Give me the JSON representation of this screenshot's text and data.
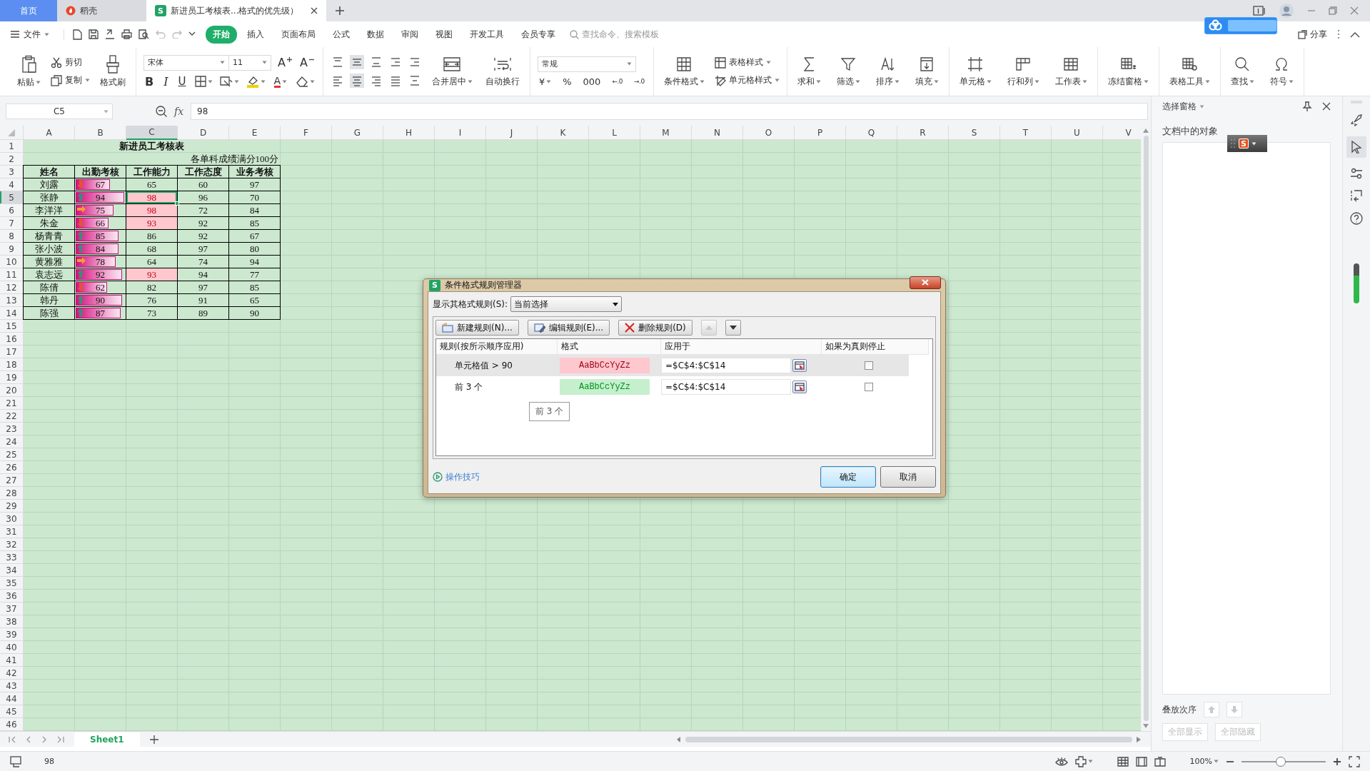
{
  "app_tabs": [
    {
      "label": "首页",
      "kind": "home",
      "selected": false
    },
    {
      "label": "稻壳",
      "kind": "docer",
      "selected": false
    },
    {
      "label": "新进员工考核表...格式的优先级）",
      "kind": "sheet",
      "logo": "S",
      "selected": true
    }
  ],
  "menu": {
    "file": "文件",
    "tabs": [
      {
        "label": "开始",
        "selected": true
      },
      {
        "label": "插入",
        "selected": false
      },
      {
        "label": "页面布局",
        "selected": false
      },
      {
        "label": "公式",
        "selected": false
      },
      {
        "label": "数据",
        "selected": false
      },
      {
        "label": "审阅",
        "selected": false
      },
      {
        "label": "视图",
        "selected": false
      },
      {
        "label": "开发工具",
        "selected": false
      },
      {
        "label": "会员专享",
        "selected": false
      }
    ],
    "search": {
      "placeholder": "查找命令、搜索模板"
    },
    "share": "分享"
  },
  "ribbon": {
    "paste": "粘贴",
    "cut": "剪切",
    "copy": "复制",
    "format_painter": "格式刷",
    "font": "宋体",
    "font_size": "11",
    "grow_font": "A",
    "shrink_font": "A",
    "bold": "B",
    "italic": "I",
    "underline": "U",
    "font_color": "A",
    "merge": "合并居中",
    "wrap": "自动换行",
    "number_format": "常规",
    "currency": "¥",
    "percent": "%",
    "thousands": "000",
    "decimal_increase": "←.0",
    "decimal_decrease": "→.0",
    "conditional_format": "条件格式",
    "table_style": "表格样式",
    "cell_style": "单元格样式",
    "tools": [
      "求和",
      "筛选",
      "排序",
      "填充",
      "单元格",
      "行和列",
      "工作表",
      "冻结窗格",
      "表格工具",
      "查找",
      "符号"
    ]
  },
  "formula_bar": {
    "cell_ref": "C5",
    "fx": "fx",
    "value": "98"
  },
  "sheet": {
    "columns": [
      {
        "label": "A",
        "selected": false
      },
      {
        "label": "B",
        "selected": false
      },
      {
        "label": "C",
        "selected": true
      },
      {
        "label": "D",
        "selected": false
      },
      {
        "label": "E",
        "selected": false
      },
      {
        "label": "F",
        "selected": false
      },
      {
        "label": "G",
        "selected": false
      },
      {
        "label": "H",
        "selected": false
      },
      {
        "label": "I",
        "selected": false
      },
      {
        "label": "J",
        "selected": false
      },
      {
        "label": "K",
        "selected": false
      },
      {
        "label": "L",
        "selected": false
      },
      {
        "label": "M",
        "selected": false
      },
      {
        "label": "N",
        "selected": false
      },
      {
        "label": "O",
        "selected": false
      },
      {
        "label": "P",
        "selected": false
      },
      {
        "label": "Q",
        "selected": false
      },
      {
        "label": "R",
        "selected": false
      },
      {
        "label": "S",
        "selected": false
      },
      {
        "label": "T",
        "selected": false
      },
      {
        "label": "U",
        "selected": false
      },
      {
        "label": "V",
        "selected": false
      }
    ],
    "row_headers": [
      {
        "label": "1",
        "selected": false
      },
      {
        "label": "2",
        "selected": false
      },
      {
        "label": "3",
        "selected": false
      },
      {
        "label": "4",
        "selected": false
      },
      {
        "label": "5",
        "selected": true
      },
      {
        "label": "6",
        "selected": false
      },
      {
        "label": "7",
        "selected": false
      },
      {
        "label": "8",
        "selected": false
      },
      {
        "label": "9",
        "selected": false
      },
      {
        "label": "10",
        "selected": false
      },
      {
        "label": "11",
        "selected": false
      },
      {
        "label": "12",
        "selected": false
      },
      {
        "label": "13",
        "selected": false
      },
      {
        "label": "14",
        "selected": false
      },
      {
        "label": "15",
        "selected": false
      },
      {
        "label": "16",
        "selected": false
      },
      {
        "label": "17",
        "selected": false
      },
      {
        "label": "18",
        "selected": false
      },
      {
        "label": "19",
        "selected": false
      },
      {
        "label": "20",
        "selected": false
      },
      {
        "label": "21",
        "selected": false
      },
      {
        "label": "22",
        "selected": false
      },
      {
        "label": "23",
        "selected": false
      },
      {
        "label": "24",
        "selected": false
      },
      {
        "label": "25",
        "selected": false
      },
      {
        "label": "26",
        "selected": false
      },
      {
        "label": "27",
        "selected": false
      },
      {
        "label": "28",
        "selected": false
      },
      {
        "label": "29",
        "selected": false
      },
      {
        "label": "30",
        "selected": false
      },
      {
        "label": "31",
        "selected": false
      },
      {
        "label": "32",
        "selected": false
      },
      {
        "label": "33",
        "selected": false
      },
      {
        "label": "34",
        "selected": false
      },
      {
        "label": "35",
        "selected": false
      },
      {
        "label": "36",
        "selected": false
      },
      {
        "label": "37",
        "selected": false
      },
      {
        "label": "38",
        "selected": false
      },
      {
        "label": "39",
        "selected": false
      },
      {
        "label": "40",
        "selected": false
      },
      {
        "label": "41",
        "selected": false
      },
      {
        "label": "42",
        "selected": false
      },
      {
        "label": "43",
        "selected": false
      },
      {
        "label": "44",
        "selected": false
      },
      {
        "label": "45",
        "selected": false
      },
      {
        "label": "46",
        "selected": false
      }
    ],
    "title": "新进员工考核表",
    "note": "各单科成绩满分100分",
    "headers": [
      "姓名",
      "出勤考核",
      "工作能力",
      "工作态度",
      "业务考核"
    ],
    "records": [
      {
        "name": "刘露",
        "attendance": "67",
        "kind": "down",
        "level": 0.7,
        "ability": "65",
        "ability_highlight": false,
        "ability_selected": false,
        "attitude": "60",
        "business": "97"
      },
      {
        "name": "张静",
        "attendance": "94",
        "kind": "up",
        "level": 0.99,
        "ability": "98",
        "ability_highlight": true,
        "ability_selected": true,
        "attitude": "96",
        "business": "70"
      },
      {
        "name": "李洋洋",
        "attendance": "75",
        "kind": "right",
        "level": 0.78,
        "ability": "98",
        "ability_highlight": true,
        "ability_selected": false,
        "attitude": "72",
        "business": "84"
      },
      {
        "name": "朱金",
        "attendance": "66",
        "kind": "down",
        "level": 0.68,
        "ability": "93",
        "ability_highlight": true,
        "ability_selected": false,
        "attitude": "92",
        "business": "85"
      },
      {
        "name": "杨青青",
        "attendance": "85",
        "kind": "up",
        "level": 0.88,
        "ability": "86",
        "ability_highlight": false,
        "ability_selected": false,
        "attitude": "92",
        "business": "67"
      },
      {
        "name": "张小波",
        "attendance": "84",
        "kind": "up",
        "level": 0.88,
        "ability": "68",
        "ability_highlight": false,
        "ability_selected": false,
        "attitude": "97",
        "business": "80"
      },
      {
        "name": "黄雅雅",
        "attendance": "78",
        "kind": "right",
        "level": 0.81,
        "ability": "64",
        "ability_highlight": false,
        "ability_selected": false,
        "attitude": "74",
        "business": "94"
      },
      {
        "name": "袁志远",
        "attendance": "92",
        "kind": "up",
        "level": 0.95,
        "ability": "93",
        "ability_highlight": true,
        "ability_selected": false,
        "attitude": "94",
        "business": "77"
      },
      {
        "name": "陈倩",
        "attendance": "62",
        "kind": "down",
        "level": 0.65,
        "ability": "82",
        "ability_highlight": false,
        "ability_selected": false,
        "attitude": "97",
        "business": "85"
      },
      {
        "name": "韩丹",
        "attendance": "90",
        "kind": "up",
        "level": 0.94,
        "ability": "76",
        "ability_highlight": false,
        "ability_selected": false,
        "attitude": "91",
        "business": "65"
      },
      {
        "name": "陈强",
        "attendance": "87",
        "kind": "up",
        "level": 0.91,
        "ability": "73",
        "ability_highlight": false,
        "ability_selected": false,
        "attitude": "89",
        "business": "90"
      }
    ],
    "sheet_tabs": [
      {
        "label": "Sheet1",
        "selected": true
      }
    ]
  },
  "dialog": {
    "logo": "S",
    "title": "条件格式规则管理器",
    "filter_label": "显示其格式规则(S):",
    "filter_value": "当前选择",
    "buttons": [
      {
        "label": "新建规则(N)...",
        "kind": "new"
      },
      {
        "label": "编辑规则(E)...",
        "kind": "edit"
      },
      {
        "label": "删除规则(D)",
        "kind": "delete"
      }
    ],
    "move_up": {
      "disabled": true
    },
    "move_down": {
      "disabled": false
    },
    "columns": [
      "规则(按所示顺序应用)",
      "格式",
      "应用于",
      "如果为真则停止"
    ],
    "rules": [
      {
        "rule": "单元格值 > 90",
        "preview": "AaBbCcYyZz",
        "color": "#ffc7ce",
        "applies_to": "=$C$4:$C$14",
        "stop": false,
        "selected": true
      },
      {
        "rule": "前 3 个",
        "preview": "AaBbCcYyZz",
        "color": "#c6efce",
        "applies_to": "=$C$4:$C$14",
        "stop": false,
        "selected": false
      }
    ],
    "tooltip": "前 3 个",
    "help_link": "操作技巧",
    "ok": "确定",
    "cancel": "取消"
  },
  "pane": {
    "title": "选择窗格",
    "objects_label": "文档中的对象",
    "ime_logo": "S",
    "order_label": "叠放次序",
    "show_all": {
      "label": "全部显示",
      "disabled": true
    },
    "hide_all": {
      "label": "全部隐藏",
      "disabled": true
    }
  },
  "status_bar": {
    "value": "98",
    "zoom": "100%",
    "level": 0.47
  }
}
